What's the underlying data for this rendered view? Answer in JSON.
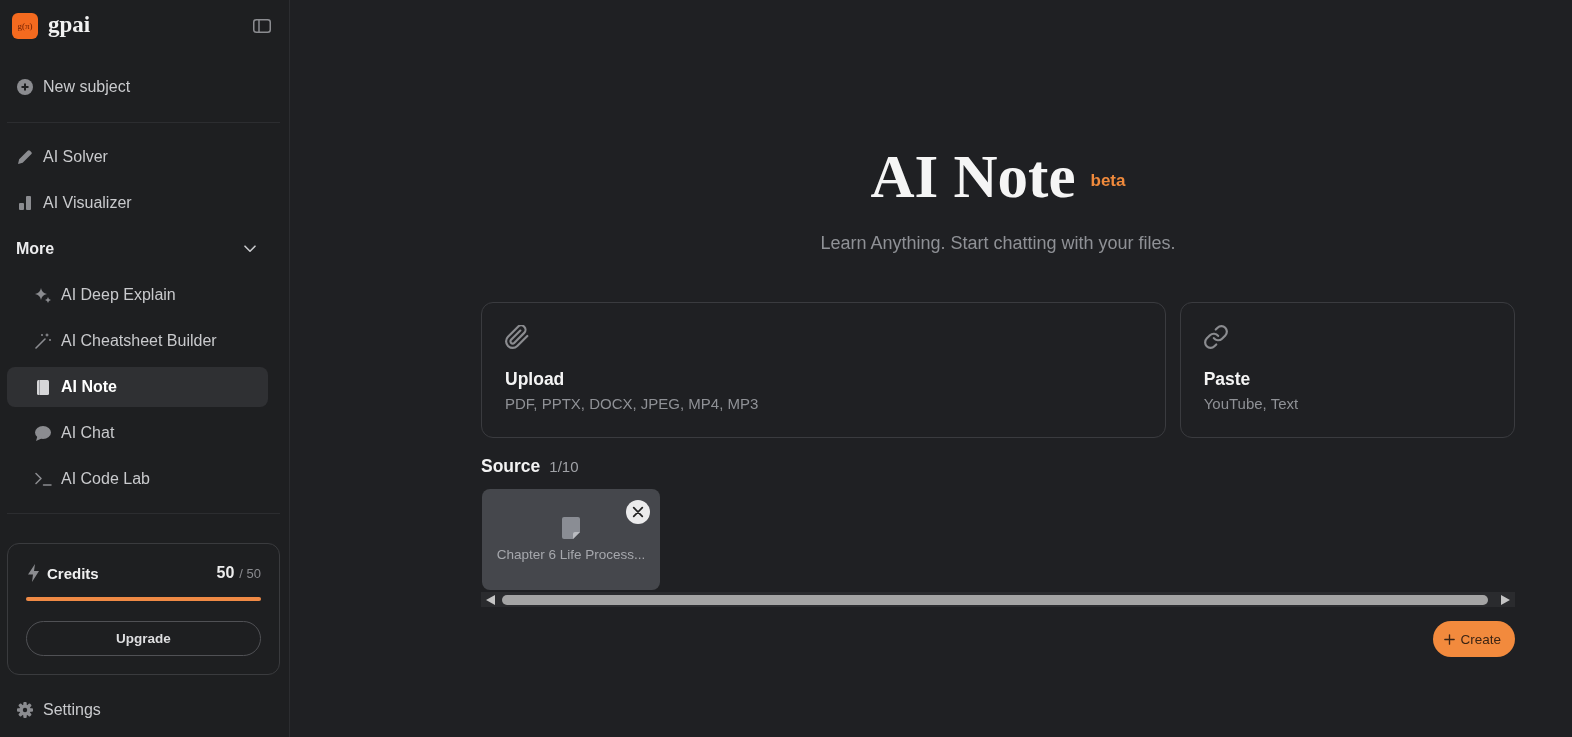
{
  "sidebar": {
    "logo": {
      "mark": "g(π)",
      "name": "gpai"
    },
    "new_subject": "New subject",
    "items": [
      {
        "label": "AI Solver",
        "selected": false
      },
      {
        "label": "AI Visualizer",
        "selected": false
      }
    ],
    "more": {
      "label": "More",
      "expanded": true,
      "items": [
        {
          "label": "AI Deep Explain",
          "selected": false
        },
        {
          "label": "AI Cheatsheet Builder",
          "selected": false
        },
        {
          "label": "AI Note",
          "selected": true
        },
        {
          "label": "AI Chat",
          "selected": false
        },
        {
          "label": "AI Code Lab",
          "selected": false
        }
      ]
    },
    "credits": {
      "label": "Credits",
      "remaining": "50",
      "total": "/ 50",
      "level": 1
    },
    "upgrade": "Upgrade",
    "settings": "Settings"
  },
  "main": {
    "title": "AI Note",
    "badge": "beta",
    "subtitle": "Learn Anything. Start chatting with your files.",
    "options": [
      {
        "kind": "upload",
        "title": "Upload",
        "formats": "PDF, PPTX, DOCX, JPEG, MP4, MP3"
      },
      {
        "kind": "paste",
        "title": "Paste",
        "formats": "YouTube, Text"
      }
    ],
    "source": {
      "label": "Source",
      "count": "1/10",
      "files": [
        {
          "name": "Chapter 6 Life Process..."
        }
      ]
    },
    "create": "Create"
  }
}
